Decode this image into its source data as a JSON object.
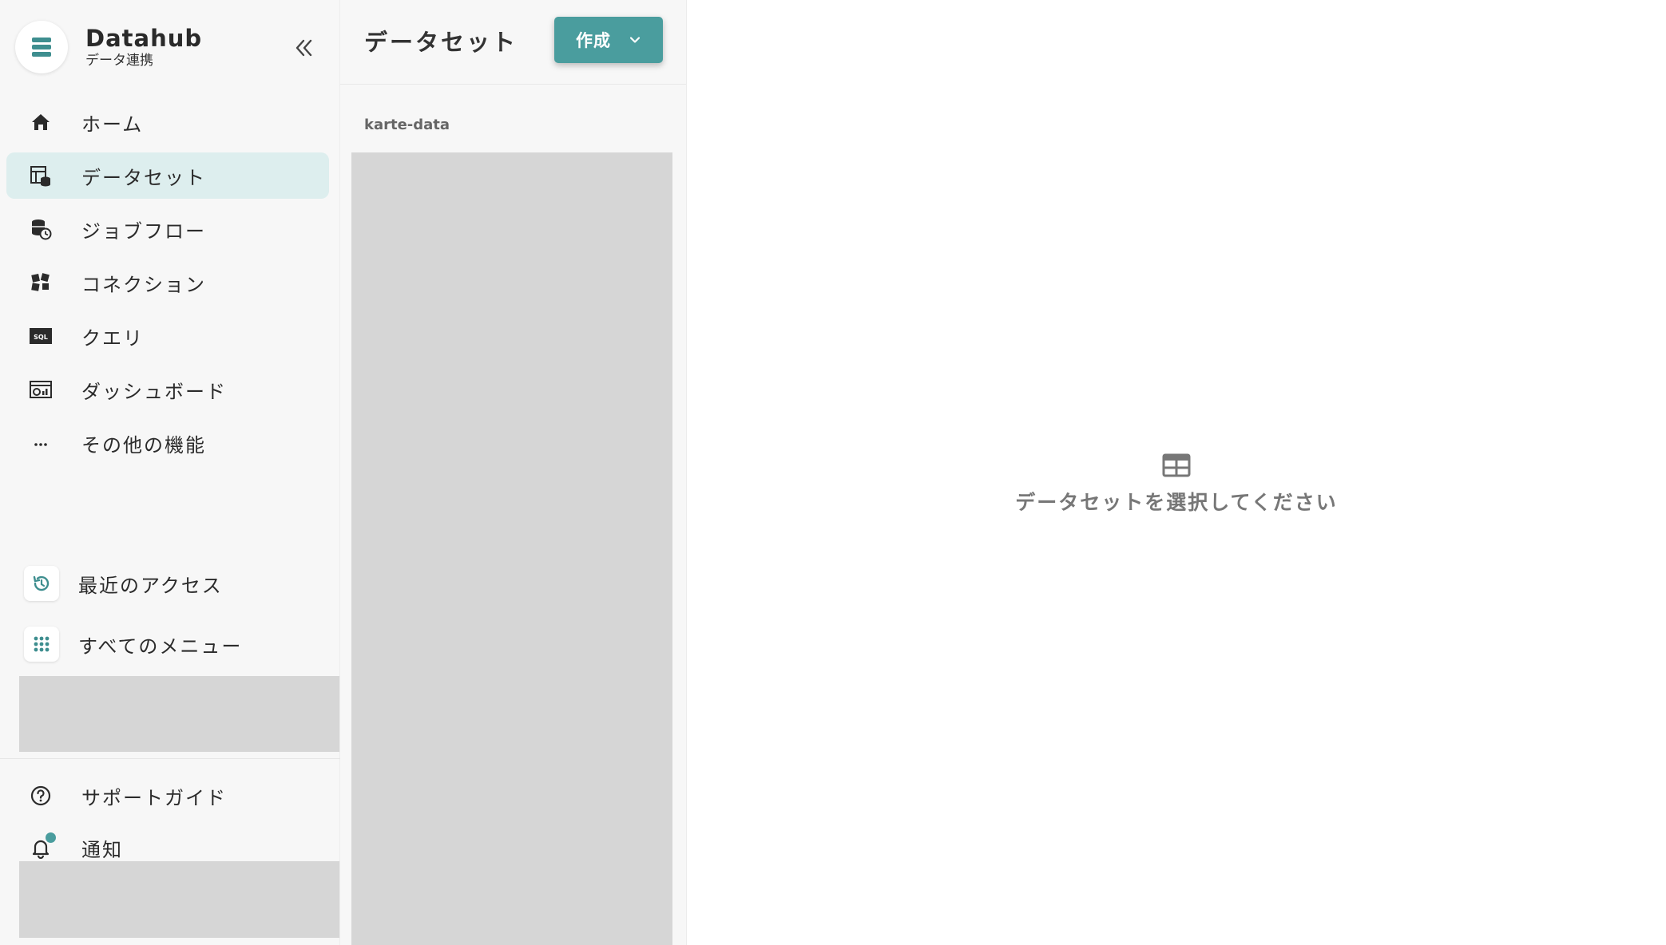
{
  "brand": {
    "title": "Datahub",
    "subtitle": "データ連携"
  },
  "nav": {
    "items": [
      {
        "label": "ホーム",
        "icon": "home-icon"
      },
      {
        "label": "データセット",
        "icon": "dataset-icon",
        "active": true
      },
      {
        "label": "ジョブフロー",
        "icon": "jobflow-icon"
      },
      {
        "label": "コネクション",
        "icon": "connection-icon"
      },
      {
        "label": "クエリ",
        "icon": "sql-icon"
      },
      {
        "label": "ダッシュボード",
        "icon": "dashboard-icon"
      },
      {
        "label": "その他の機能",
        "icon": "more-icon"
      }
    ]
  },
  "quick": {
    "recent_label": "最近のアクセス",
    "all_menu_label": "すべてのメニュー"
  },
  "bottom": {
    "support_label": "サポートガイド",
    "notify_label": "通知"
  },
  "panel": {
    "title": "データセット",
    "create_label": "作成",
    "group_label": "karte-data"
  },
  "main": {
    "empty_text": "データセットを選択してください"
  },
  "colors": {
    "accent": "#4a9d9e",
    "active_bg": "#ddeeee",
    "placeholder_gray": "#d6d6d6"
  }
}
